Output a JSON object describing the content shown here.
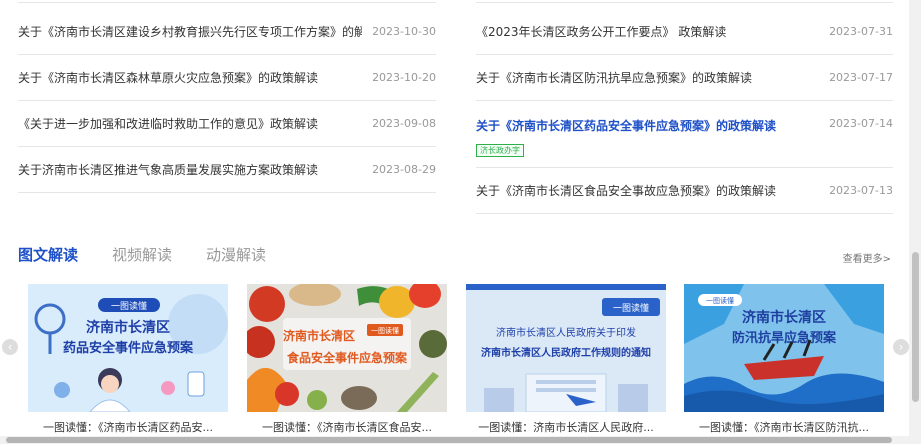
{
  "left_list": [
    {
      "title": "关于《济南市长清区建设乡村教育振兴先行区专项工作方案》的解读",
      "date": "2023-10-30"
    },
    {
      "title": "关于《济南市长清区森林草原火灾应急预案》的政策解读",
      "date": "2023-10-20"
    },
    {
      "title": "《关于进一步加强和改进临时救助工作的意见》政策解读",
      "date": "2023-09-08"
    },
    {
      "title": "关于济南市长清区推进气象高质量发展实施方案政策解读",
      "date": "2023-08-29"
    }
  ],
  "right_list": [
    {
      "title": "《2023年长清区政务公开工作要点》 政策解读",
      "date": "2023-07-31"
    },
    {
      "title": "关于《济南市长清区防汛抗旱应急预案》的政策解读",
      "date": "2023-07-17"
    },
    {
      "title": "关于《济南市长清区药品安全事件应急预案》的政策解读",
      "date": "2023-07-14",
      "tag": "济长政办字"
    },
    {
      "title": "关于《济南市长清区食品安全事故应急预案》的政策解读",
      "date": "2023-07-13"
    }
  ],
  "tabs": [
    "图文解读",
    "视频解读",
    "动漫解读"
  ],
  "more_label": "查看更多>",
  "cards": [
    {
      "caption": "一图读懂：《济南市长清区药品安...",
      "badge": "一图读懂",
      "line1": "济南市长清区",
      "line2": "药品安全事件应急预案"
    },
    {
      "caption": "一图读懂：《济南市长清区食品安...",
      "badge": "一图读懂",
      "line1": "济南市长清区",
      "line2": "食品安全事件应急预案"
    },
    {
      "caption": "一图读懂：济南市长清区人民政府...",
      "badge": "一图读懂",
      "line1": "济南市长清区人民政府关于印发",
      "line2": "济南市长清区人民政府工作规则的通知"
    },
    {
      "caption": "一图读懂：《济南市长清区防汛抗...",
      "badge": "一图读懂",
      "line1": "济南市长清区",
      "line2": "防汛抗旱应急预案"
    }
  ],
  "colors": {
    "accent": "#1e50c8",
    "tag_green": "#2db04b",
    "date_gray": "#999999"
  },
  "icons": {
    "prev": "chevron-left-icon",
    "next": "chevron-right-icon"
  }
}
